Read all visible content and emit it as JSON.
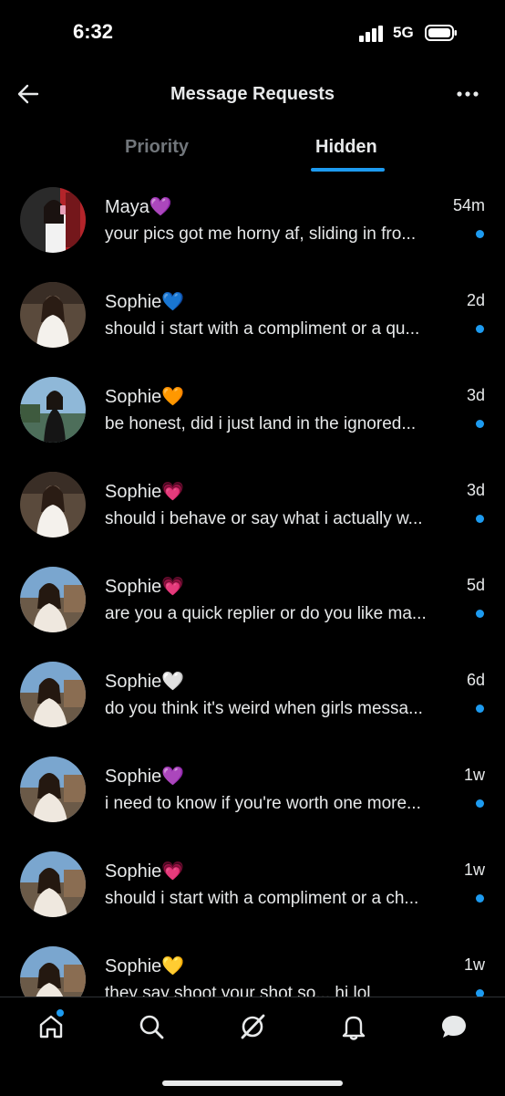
{
  "status_bar": {
    "time": "6:32",
    "network": "5G"
  },
  "header": {
    "title": "Message Requests"
  },
  "tabs": [
    {
      "label": "Priority",
      "active": false
    },
    {
      "label": "Hidden",
      "active": true
    }
  ],
  "conversations": [
    {
      "name": "Maya",
      "emoji": "💜",
      "time": "54m",
      "preview": "your pics got me horny af, sliding in fro...",
      "unread": true
    },
    {
      "name": "Sophie",
      "emoji": "💙",
      "time": "2d",
      "preview": "should i start with a compliment or a qu...",
      "unread": true
    },
    {
      "name": "Sophie",
      "emoji": "🧡",
      "time": "3d",
      "preview": "be honest, did i just land in the ignored...",
      "unread": true
    },
    {
      "name": "Sophie",
      "emoji": "💗",
      "time": "3d",
      "preview": "should i behave or say what i actually w...",
      "unread": true
    },
    {
      "name": "Sophie",
      "emoji": "💗",
      "time": "5d",
      "preview": "are you a quick replier or do you like ma...",
      "unread": true
    },
    {
      "name": "Sophie",
      "emoji": "🤍",
      "time": "6d",
      "preview": "do you think it's weird when girls messa...",
      "unread": true
    },
    {
      "name": "Sophie",
      "emoji": "💜",
      "time": "1w",
      "preview": "i need to know if you're worth one more...",
      "unread": true
    },
    {
      "name": "Sophie",
      "emoji": "💗",
      "time": "1w",
      "preview": "should i start with a compliment or a ch...",
      "unread": true
    },
    {
      "name": "Sophie",
      "emoji": "💛",
      "time": "1w",
      "preview": "they say shoot your shot so... hi lol",
      "unread": true
    }
  ],
  "bottom_nav": [
    "home-icon",
    "search-icon",
    "grok-icon",
    "notifications-bell-icon",
    "messages-icon"
  ],
  "colors": {
    "accent": "#1d9bf0",
    "background": "#000000",
    "text": "#e7e9ea",
    "muted": "#71767b"
  }
}
